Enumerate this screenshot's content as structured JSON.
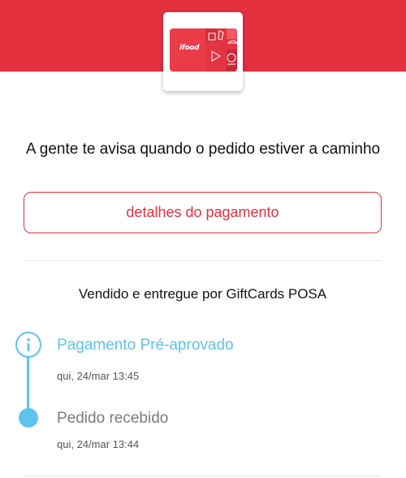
{
  "colors": {
    "brand": "#e4303f",
    "timeline": "#5ec3ef",
    "muted": "#7b7b7b"
  },
  "gift_card": {
    "brand_text": "ifood"
  },
  "message": "A gente te avisa quando o pedido estiver a caminho",
  "details_button": {
    "label": "detalhes do pagamento"
  },
  "seller": "Vendido e entregue por GiftCards POSA",
  "timeline": {
    "steps": [
      {
        "title": "Pagamento Pré-aprovado",
        "time": "qui, 24/mar 13:45",
        "icon": "info-icon",
        "active": true
      },
      {
        "title": "Pedido recebido",
        "time": "qui, 24/mar 13:44",
        "icon": "dot-icon",
        "active": false
      }
    ]
  }
}
